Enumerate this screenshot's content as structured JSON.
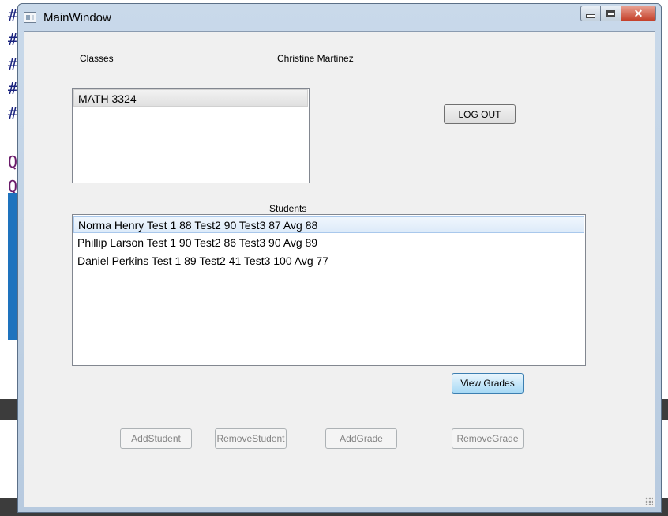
{
  "window": {
    "title": "MainWindow",
    "close_glyph": "✕"
  },
  "classes": {
    "label": "Classes",
    "items": [
      "MATH 3324"
    ],
    "selected_index": 0
  },
  "user": {
    "name": "Christine Martinez"
  },
  "logout_label": "LOG OUT",
  "students": {
    "label": "Students",
    "items": [
      "Norma Henry Test 1 88 Test2 90 Test3 87 Avg 88",
      "Phillip Larson Test 1 90 Test2 86 Test3 90 Avg 89",
      "Daniel Perkins Test 1 89 Test2 41 Test3 100 Avg 77"
    ],
    "selected_index": 0
  },
  "buttons": {
    "view_grades": "View Grades",
    "add_student": "AddStudent",
    "remove_student": "RemoveStudent",
    "add_grade": "AddGrade",
    "remove_grade": "RemoveGrade"
  },
  "icons": {
    "app": "app-window-icon",
    "minimize": "minimize-icon",
    "maximize": "maximize-icon",
    "close": "close-icon"
  }
}
